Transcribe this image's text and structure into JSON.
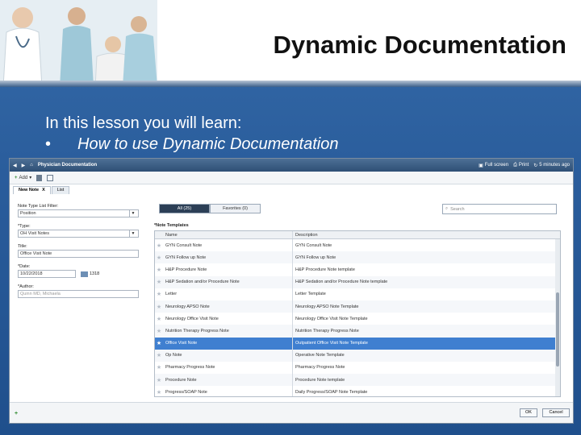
{
  "slide": {
    "title": "Dynamic Documentation",
    "lesson_intro": "In this lesson you will learn:",
    "bullet_char": "•",
    "bullet_item": "How to use Dynamic Documentation"
  },
  "app": {
    "window_title": "Physician Documentation",
    "fullscreen_label": "Full screen",
    "print_label": "Print",
    "refresh_label": "5 minutes ago",
    "add_label": "Add",
    "tabs": [
      {
        "label": "New Note",
        "close": "X"
      },
      {
        "label": "List"
      }
    ],
    "form": {
      "filter_label": "Note Type List Filter:",
      "filter_value": "Position",
      "type_label": "*Type:",
      "type_value": "OH Visit Notes",
      "title_label": "Title:",
      "title_value": "Office Visit Note",
      "date_label": "*Date:",
      "date_value": "10/22/2018",
      "time_value": "1318",
      "author_label": "*Author:",
      "author_placeholder": "Quinn MD, Michaela"
    },
    "segments": {
      "all": "All (25)",
      "favorites": "Favorites (0)"
    },
    "search_placeholder": "Search",
    "templates_label": "*Note Templates",
    "columns": {
      "name": "Name",
      "description": "Description"
    },
    "rows": [
      {
        "name": "GYN Consult Note",
        "description": "GYN Consult Note",
        "selected": false
      },
      {
        "name": "GYN Follow up Note",
        "description": "GYN Follow up Note",
        "selected": false
      },
      {
        "name": "H&P Procedure Note",
        "description": "H&P Procedure Note template",
        "selected": false
      },
      {
        "name": "H&P Sedation and/or Procedure Note",
        "description": "H&P Sedation and/or Procedure Note template",
        "selected": false
      },
      {
        "name": "Letter",
        "description": "Letter Template",
        "selected": false
      },
      {
        "name": "Neurology APSO Note",
        "description": "Neurology APSO Note Template",
        "selected": false
      },
      {
        "name": "Neurology Office Visit Note",
        "description": "Neurology Office Visit Note Template",
        "selected": false
      },
      {
        "name": "Nutrition Therapy Progress Note",
        "description": "Nutrition Therapy Progress Note",
        "selected": false
      },
      {
        "name": "Office Visit Note",
        "description": "Outpatient Office Visit Note Template",
        "selected": true
      },
      {
        "name": "Op Note",
        "description": "Operative Note Template",
        "selected": false
      },
      {
        "name": "Pharmacy Progress Note",
        "description": "Pharmacy Progress Note",
        "selected": false
      },
      {
        "name": "Procedure Note",
        "description": "Procedure Note template",
        "selected": false
      },
      {
        "name": "Progress/SOAP Note",
        "description": "Daily Progress/SOAP Note Template",
        "selected": false
      }
    ],
    "ok_label": "OK",
    "cancel_label": "Cancel"
  },
  "colors": {
    "slide_bg": "#2a5d9c",
    "selected_row": "#3f7fd0",
    "titlebar": "#2e4f75"
  }
}
